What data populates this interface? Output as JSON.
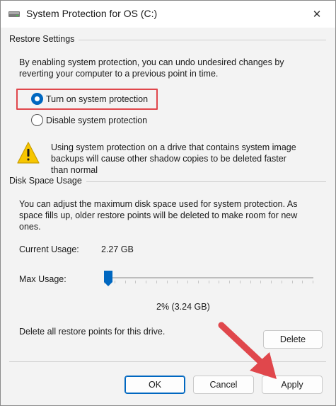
{
  "window": {
    "title": "System Protection for OS (C:)",
    "close_glyph": "✕",
    "icon": "drive-icon"
  },
  "restore_settings": {
    "group_label": "Restore Settings",
    "description_line1": "By enabling system protection, you can undo undesired changes by",
    "description_line2": "reverting your computer to a previous point in time.",
    "options": [
      {
        "label": "Turn on system protection",
        "selected": true
      },
      {
        "label": "Disable system protection",
        "selected": false
      }
    ],
    "warning_line1": "Using system protection on a drive that contains system image",
    "warning_line2": "backups will cause other shadow copies to be deleted faster",
    "warning_line3": "than normal"
  },
  "disk_space": {
    "group_label": "Disk Space Usage",
    "description_line1": "You can adjust the maximum disk space used for system protection. As",
    "description_line2": "space fills up, older restore points will be deleted to make room for new",
    "description_line3": "ones.",
    "current_usage_label": "Current Usage:",
    "current_usage_value": "2.27 GB",
    "max_usage_label": "Max Usage:",
    "max_usage_percent": 2,
    "max_usage_readout": "2% (3.24 GB)",
    "delete_text": "Delete all restore points for this drive.",
    "delete_button": "Delete"
  },
  "buttons": {
    "ok": "OK",
    "cancel": "Cancel",
    "apply": "Apply"
  },
  "colors": {
    "accent": "#0067c0",
    "highlight": "#e0474c",
    "warning": "#f7c600"
  }
}
